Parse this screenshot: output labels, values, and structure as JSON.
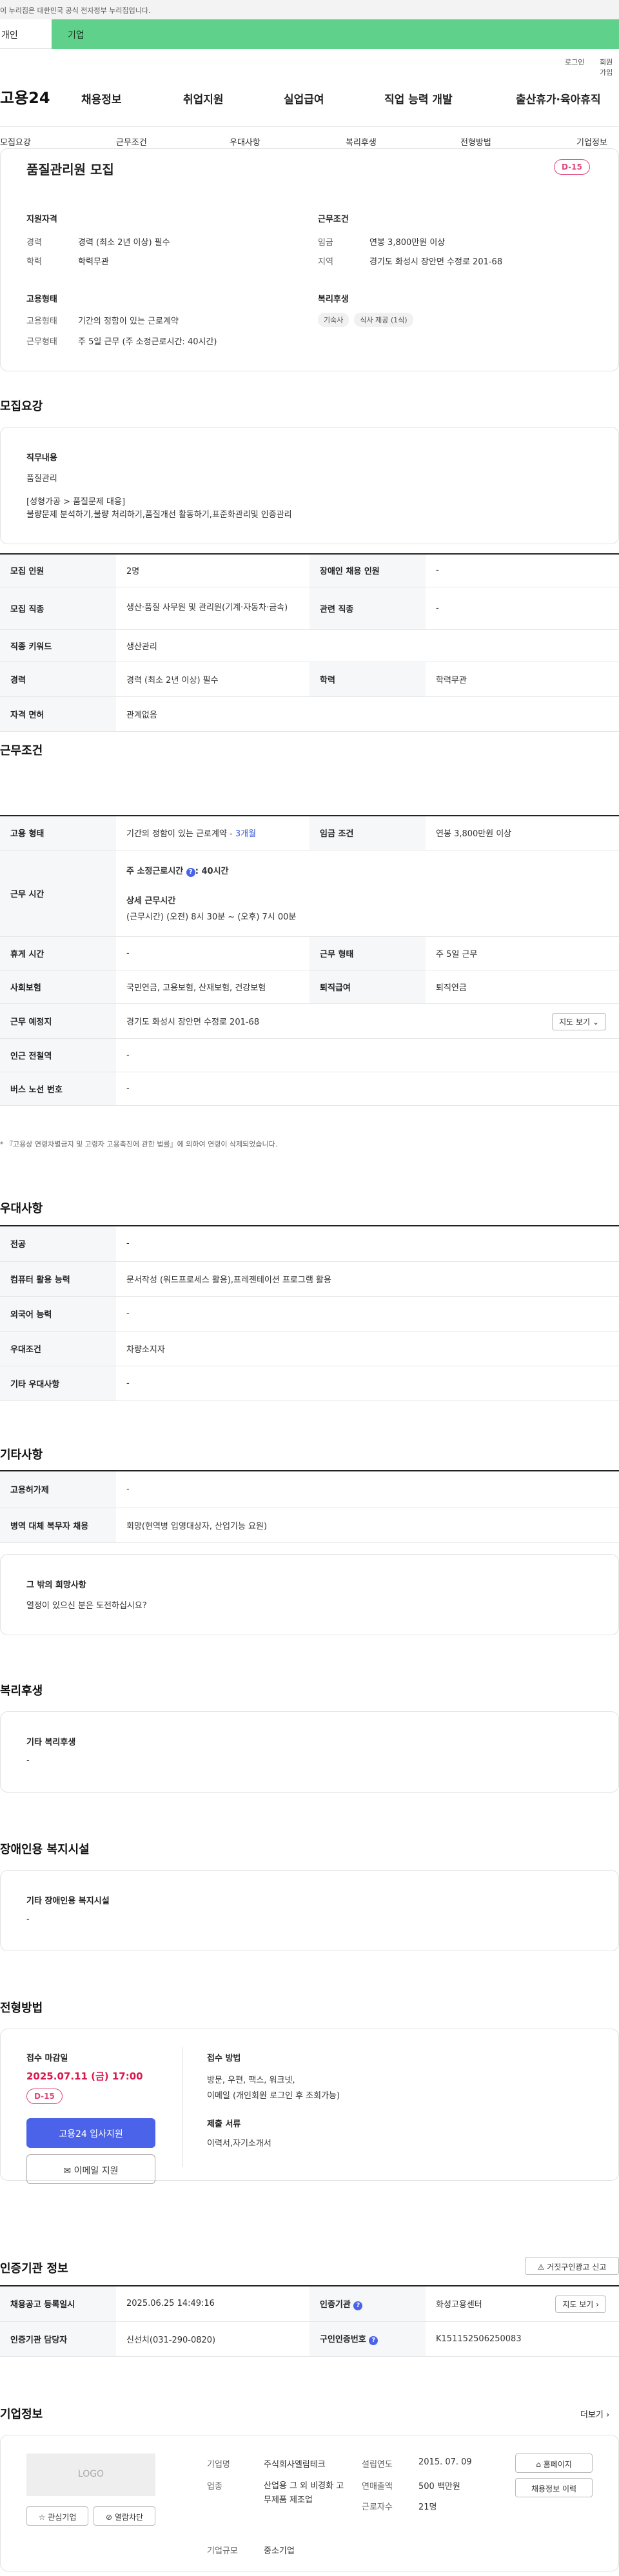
{
  "gov_banner": "이 누리집은 대한민국 공식 전자정부 누리집입니다.",
  "top_tabs": [
    "개인",
    "기업"
  ],
  "util_links": [
    "로그인",
    "회원가입"
  ],
  "brand": "고용24",
  "gnb": [
    "채용정보",
    "취업지원",
    "실업급여",
    "직업 능력 개발",
    "출산휴가·육아휴직"
  ],
  "lnb": [
    "모집요강",
    "근무조건",
    "우대사항",
    "복리후생",
    "전형방법",
    "기업정보"
  ],
  "job": {
    "title": "품질관리원 모집",
    "dday": "D-15",
    "qual_heading": "지원자격",
    "cond_heading": "근무조건",
    "career_label": "경력",
    "career_value": "경력 (최소 2년 이상) 필수",
    "edu_label": "학력",
    "edu_value": "학력무관",
    "wage_label": "임금",
    "wage_value": "연봉 3,800만원 이상",
    "region_label": "지역",
    "region_value": "경기도 화성시 장안면 수정로 201-68",
    "emp_heading": "고용형태",
    "welfare_heading": "복리후생",
    "emp_type_label": "고용형태",
    "emp_type_value": "기간의 정함이 있는 근로계약",
    "work_type_label": "근무형태",
    "work_type_value": "주 5일 근무 (주 소정근로시간: 40시간)",
    "welfare_chips": [
      "기숙사",
      "식사 제공 (1식)"
    ]
  },
  "recruit": {
    "heading": "모집요강",
    "duty_heading": "직무내용",
    "duty_name": "품질관리",
    "duty_desc1": "[성형가공 > 품질문제 대응]",
    "duty_desc2": "불량문제 분석하기,불량 처리하기,품질개선 활동하기,표준화관리및 인증관리",
    "rows": [
      {
        "k1": "모집 인원",
        "v1": "2명",
        "k2": "장애인 채용 인원",
        "v2": "-"
      },
      {
        "k1": "모집 직종",
        "v1": "생산·품질 사무원 및 관리원(기계·자동차·금속)",
        "k2": "관련 직종",
        "v2": "-"
      },
      {
        "k1": "직종 키워드",
        "v1": "생산관리"
      },
      {
        "k1": "경력",
        "v1": "경력 (최소 2년 이상) 필수",
        "k2": "학력",
        "v2": "학력무관"
      },
      {
        "k1": "자격 면허",
        "v1": "관계없음"
      }
    ]
  },
  "conditions": {
    "heading": "근무조건",
    "emp_k": "고용 형태",
    "emp_v": "기간의 정함이 있는 근로계약 - ",
    "emp_link": "3개월",
    "wage_k": "임금 조건",
    "wage_v": "연봉 3,800만원 이상",
    "hours_k": "근무 시간",
    "hours_std": "주 소정근로시간 ",
    "hours_std_value": ": 40시간",
    "hours_detail_heading": "상세 근무시간",
    "hours_detail": "(근무시간) (오전) 8시 30분 ~ (오후) 7시 00분",
    "rest_k": "휴게 시간",
    "rest_v": "-",
    "form_k": "근무 형태",
    "form_v": "주 5일 근무",
    "ins_k": "사회보험",
    "ins_v": "국민연금, 고용보험, 산재보험, 건강보험",
    "retire_k": "퇴직급여",
    "retire_v": "퇴직연금",
    "place_k": "근무 예정지",
    "place_v": "경기도 화성시 장안면 수정로 201-68",
    "map_btn": "지도 보기",
    "subway_k": "인근 전철역",
    "subway_v": "-",
    "bus_k": "버스 노선 번호",
    "bus_v": "-",
    "notice": "* 『고용상 연령차별금지 및 고령자 고용촉진에 관한 법률』에 의하여 연령이 삭제되었습니다."
  },
  "preference": {
    "heading": "우대사항",
    "rows": [
      {
        "k": "전공",
        "v": "-"
      },
      {
        "k": "컴퓨터 활용 능력",
        "v": "문서작성 (워드프로세스 활용),프레젠테이션 프로그램 활용"
      },
      {
        "k": "외국어 능력",
        "v": "-"
      },
      {
        "k": "우대조건",
        "v": "차량소지자"
      },
      {
        "k": "기타 우대사항",
        "v": "-"
      }
    ]
  },
  "etc": {
    "heading": "기타사항",
    "rows": [
      {
        "k": "고용허가제",
        "v": "-"
      },
      {
        "k": "병역 대체 복무자 채용",
        "v": "회망(현역병 입영대상자, 산업기능 요원)"
      }
    ],
    "wish_heading": "그 밖의 희망사항",
    "wish_text": "열정이 있으신 분은 도전하십시요?"
  },
  "welfare": {
    "heading": "복리후생",
    "sub": "기타 복리후생",
    "value": "-"
  },
  "disability": {
    "heading": "장애인용 복지시설",
    "sub": "기타 장애인용 복지시설",
    "value": "-"
  },
  "selection": {
    "heading": "전형방법",
    "deadline_heading": "접수 마감일",
    "deadline": "2025.07.11 (금) 17:00",
    "dday": "D-15",
    "apply_btn": "고용24 입사지원",
    "email_btn": "이메일 지원",
    "method_heading": "접수 방법",
    "method_1": "방문, 우편, 팩스, 워크넷,",
    "method_2": "이메일 (개인회원 로그인 후 조회가능)",
    "docs_heading": "제출 서류",
    "docs": "이력서,자기소개서"
  },
  "agency": {
    "heading": "인증기관 정보",
    "report_btn": "거짓구인광고 신고",
    "reg_k": "채용공고 등록일시",
    "reg_v": "2025.06.25 14:49:16",
    "org_k": "인증기관",
    "org_v": "화성고용센터",
    "map_btn": "지도 보기",
    "mgr_k": "인증기관 담당자",
    "mgr_v": "신선치(031-290-0820)",
    "num_k": "구인인증번호",
    "num_v": "K151152506250083"
  },
  "company": {
    "heading": "기업정보",
    "more": "더보기",
    "logo": "LOGO",
    "interest_btn": "관심기업",
    "block_btn": "열람차단",
    "name_k": "기업명",
    "name_v": "주식회사엘림테크",
    "industry_k": "업종",
    "industry_v": "산업용 그 외 비경화 고무제품 제조업",
    "size_k": "기업규모",
    "size_v": "중소기업",
    "founded_k": "설립연도",
    "founded_v": "2015. 07. 09",
    "sales_k": "연매출액",
    "sales_v": "500 백만원",
    "staff_k": "근로자수",
    "staff_v": "21명",
    "homepage_btn": "홈페이지",
    "jobs_btn": "채용정보 이력"
  }
}
